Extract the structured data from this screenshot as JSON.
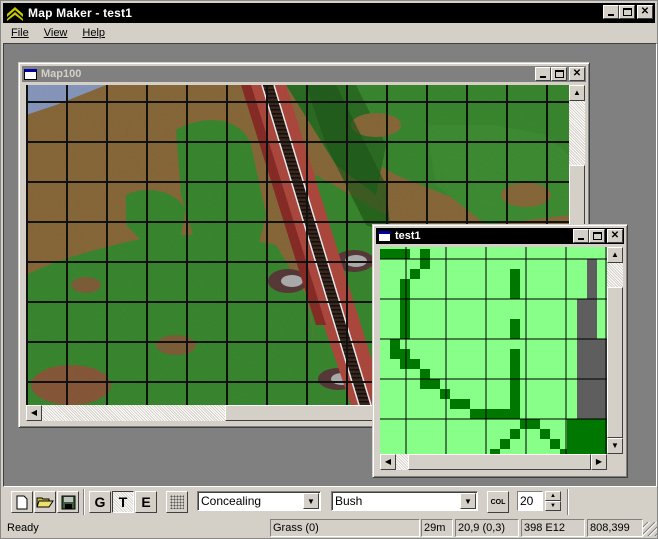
{
  "app": {
    "title": "Map Maker - test1",
    "icon": "chevron-rank-icon"
  },
  "menu": [
    {
      "label": "File",
      "accel": "F"
    },
    {
      "label": "View",
      "accel": "V"
    },
    {
      "label": "Help",
      "accel": "H"
    }
  ],
  "windows": {
    "map": {
      "title": "Map100",
      "state": "inactive"
    },
    "tiles": {
      "title": "test1",
      "state": "active"
    }
  },
  "toolbar": {
    "file_buttons": [
      {
        "name": "new",
        "icon": "new-document-icon"
      },
      {
        "name": "open",
        "icon": "open-folder-icon"
      },
      {
        "name": "save",
        "icon": "floppy-disk-icon"
      }
    ],
    "mode_buttons": [
      {
        "label": "G",
        "pressed": false
      },
      {
        "label": "T",
        "pressed": true
      },
      {
        "label": "E",
        "pressed": false
      }
    ],
    "grid_toggle_icon": "grid-dots-icon",
    "combo1_value": "Concealing",
    "combo2_value": "Bush",
    "col_label": "COL",
    "spin_value": "20"
  },
  "status": {
    "message": "Ready",
    "terrain": "Grass (0)",
    "height": "29m",
    "cell": "20,9 (0,3)",
    "code": "398 E12",
    "coords": "808,399"
  },
  "colors": {
    "tile_light": "#88ff88",
    "tile_dark": "#007700",
    "tile_gray": "#5e5e5e"
  }
}
